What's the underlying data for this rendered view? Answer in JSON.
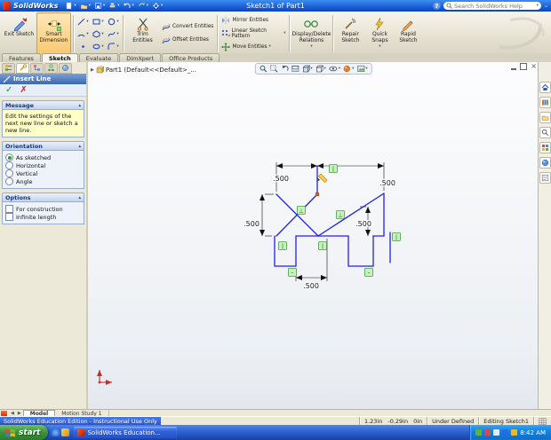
{
  "titlebar": {
    "app_name": "SolidWorks",
    "doc_title": "Sketch1 of Part1",
    "help": "?",
    "search_placeholder": "Search SolidWorks Help"
  },
  "ribbon": {
    "exit_sketch": "Exit Sketch",
    "smart_dimension": "Smart Dimension",
    "trim_entities": "Trim Entities",
    "convert_entities": "Convert Entities",
    "offset_entities": "Offset Entities",
    "mirror_entities": "Mirror Entities",
    "linear_sketch_pattern": "Linear Sketch Pattern",
    "move_entities": "Move Entities",
    "display_delete_relations": "Display/Delete Relations",
    "repair_sketch": "Repair Sketch",
    "quick_snaps": "Quick Snaps",
    "rapid_sketch": "Rapid Sketch"
  },
  "command_tabs": [
    {
      "label": "Features",
      "active": false
    },
    {
      "label": "Sketch",
      "active": true
    },
    {
      "label": "Evaluate",
      "active": false
    },
    {
      "label": "DimXpert",
      "active": false
    },
    {
      "label": "Office Products",
      "active": false
    }
  ],
  "feature_tree": {
    "root_label": "Part1 (Default<<Default>_..."
  },
  "property_panel": {
    "title": "Insert Line",
    "message_header": "Message",
    "message_body": "Edit the settings of the next new line or sketch a new line.",
    "orientation_header": "Orientation",
    "orientation_options": [
      {
        "label": "As sketched",
        "selected": true
      },
      {
        "label": "Horizontal",
        "selected": false
      },
      {
        "label": "Vertical",
        "selected": false
      },
      {
        "label": "Angle",
        "selected": false
      }
    ],
    "options_header": "Options",
    "option_items": [
      {
        "label": "For construction",
        "checked": false
      },
      {
        "label": "Infinite length",
        "checked": false
      }
    ]
  },
  "sketch": {
    "line_color": "#2222dd",
    "relation_color": "#c6f2bc",
    "dim_top_left": ".500",
    "dim_top_right": ".500",
    "dim_mid_left": ".500",
    "dim_mid_right": ".500",
    "dim_bottom": ".500"
  },
  "doc_tabs": {
    "model": "Model",
    "motion_study": "Motion Study 1"
  },
  "statusbar": {
    "edition_notice": "SolidWorks Education Edition - Instructional Use Only",
    "coord_x": "1.23in",
    "coord_y": "-0.29in",
    "coord_z": "0in",
    "definition_state": "Under Defined",
    "mode": "Editing Sketch1"
  },
  "taskbar": {
    "start_label": "start",
    "task_label": "SolidWorks Education...",
    "clock": "8:42 AM"
  }
}
